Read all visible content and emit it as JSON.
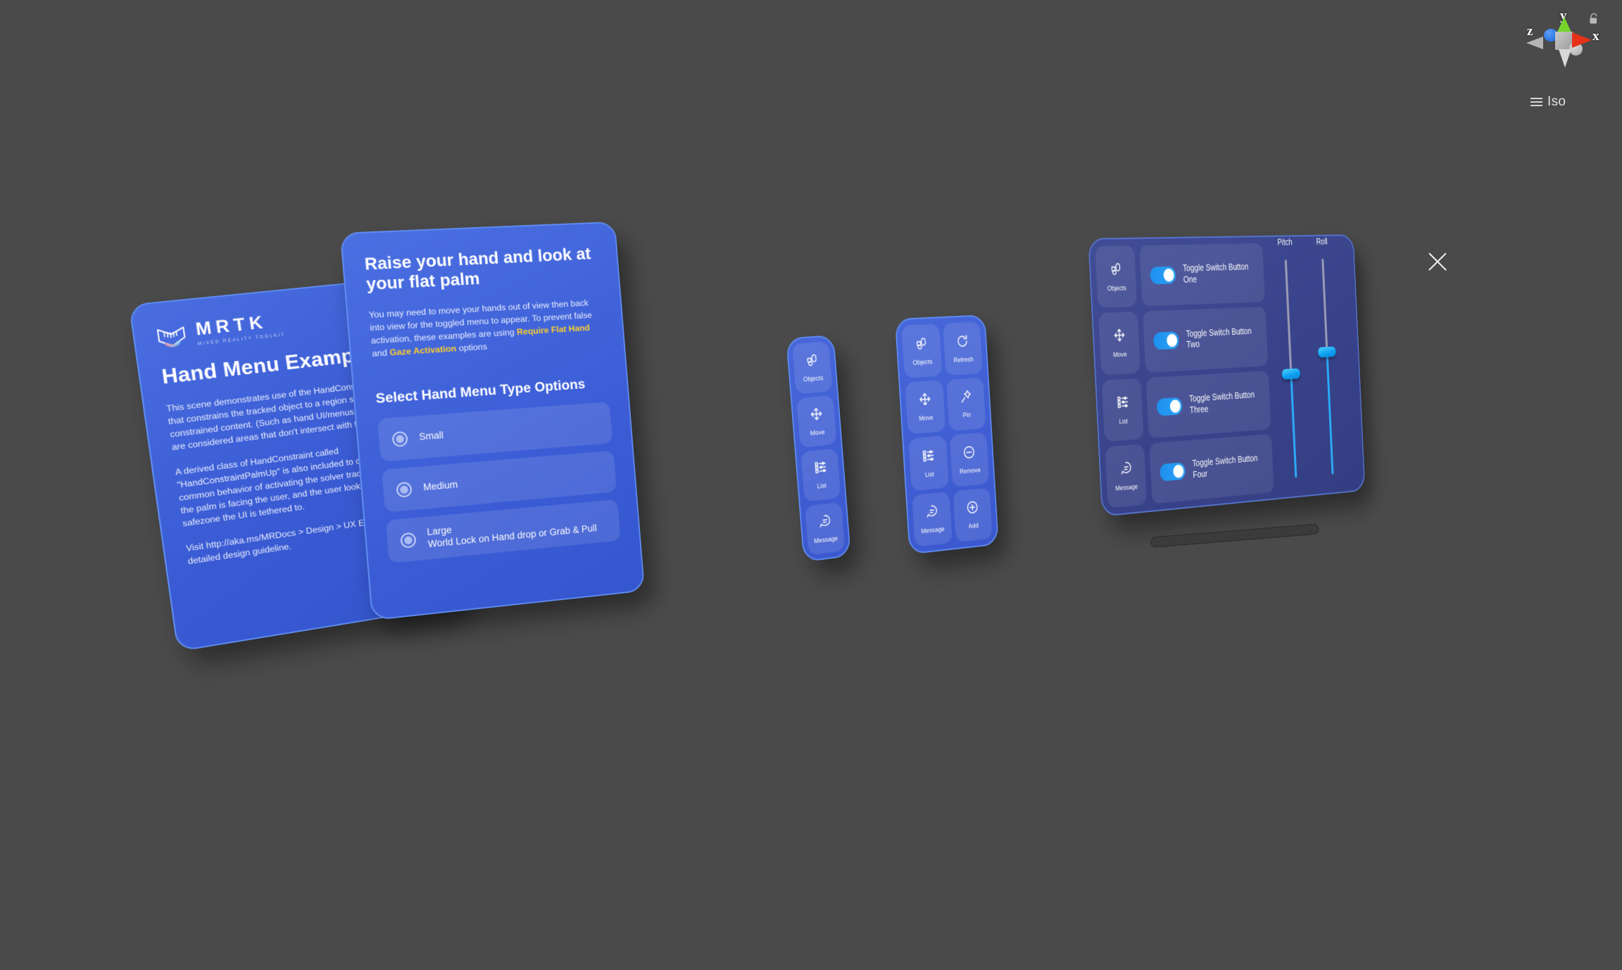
{
  "scene": {
    "background_color": "#4a4a4a",
    "accent_blue": "#3d5fd4",
    "panel_border": "#5e8bf0",
    "toggle_on_color": "#1e90ef",
    "highlight_yellow": "#ffd02a",
    "dark_panel_color": "#39438a"
  },
  "gizmo": {
    "axis_y": "y",
    "axis_x": "x",
    "axis_z": "z",
    "view_mode": "Iso",
    "lock_icon": "padlock-icon",
    "menu_icon": "hamburger-icon"
  },
  "close_button": {
    "icon": "close-x-icon"
  },
  "panel_info": {
    "logo_word": "MRTK",
    "logo_subtitle": "MIXED REALITY TOOLKIT",
    "title": "Hand Menu Examples",
    "paragraph_1": "This scene demonstrates use of the HandConstraint, a solver that constrains the tracked object to a region safe for hand constrained content. (Such as hand UI/menus.) Safe regions are considered areas that don't intersect with the hand.",
    "paragraph_2": "A derived class of HandConstraint called \"HandConstraintPalmUp\" is also included to demonstrate a common behavior of activating the solver tracked object when the palm is facing the user, and the user looks at the safezone the UI is tethered to.",
    "paragraph_3": "Visit http://aka.ms/MRDocs > Design > UX Elements for more detailed design guideline."
  },
  "panel_raise": {
    "heading": "Raise your hand and look at your flat palm",
    "body_part_1": "You may need to move your hands out of view then back into view for the toggled menu to appear. To prevent false activation, these examples are using ",
    "highlight_1": "Require Flat Hand",
    "body_part_2": " and ",
    "highlight_2": "Gaze Activation",
    "body_part_3": " options",
    "options_heading": "Select Hand Menu Type Options",
    "options": [
      {
        "label": "Small",
        "sublabel": ""
      },
      {
        "label": "Medium",
        "sublabel": ""
      },
      {
        "label": "Large",
        "sublabel": "World Lock on Hand drop or Grab & Pull"
      }
    ]
  },
  "menu_small": {
    "items": [
      {
        "label": "Objects",
        "icon": "objects-icon"
      },
      {
        "label": "Move",
        "icon": "move-icon"
      },
      {
        "label": "List",
        "icon": "list-icon"
      },
      {
        "label": "Message",
        "icon": "message-icon"
      }
    ]
  },
  "menu_medium": {
    "items": [
      {
        "label": "Objects",
        "icon": "objects-icon"
      },
      {
        "label": "Refresh",
        "icon": "refresh-icon"
      },
      {
        "label": "Move",
        "icon": "move-icon"
      },
      {
        "label": "Pin",
        "icon": "pin-icon"
      },
      {
        "label": "List",
        "icon": "list-icon"
      },
      {
        "label": "Remove",
        "icon": "remove-icon"
      },
      {
        "label": "Message",
        "icon": "message-icon"
      },
      {
        "label": "Add",
        "icon": "add-icon"
      }
    ]
  },
  "menu_large": {
    "icons": [
      {
        "label": "Objects",
        "icon": "objects-icon"
      },
      {
        "label": "Move",
        "icon": "move-icon"
      },
      {
        "label": "List",
        "icon": "list-icon"
      },
      {
        "label": "Message",
        "icon": "message-icon"
      }
    ],
    "toggles": [
      {
        "label": "Toggle Switch Button One",
        "state": "on"
      },
      {
        "label": "Toggle Switch Button Two",
        "state": "on"
      },
      {
        "label": "Toggle Switch Button Three",
        "state": "on"
      },
      {
        "label": "Toggle Switch Button Four",
        "state": "on"
      }
    ],
    "sliders": [
      {
        "label": "Pitch",
        "value_percent": 42
      },
      {
        "label": "Roll",
        "value_percent": 50
      }
    ]
  }
}
